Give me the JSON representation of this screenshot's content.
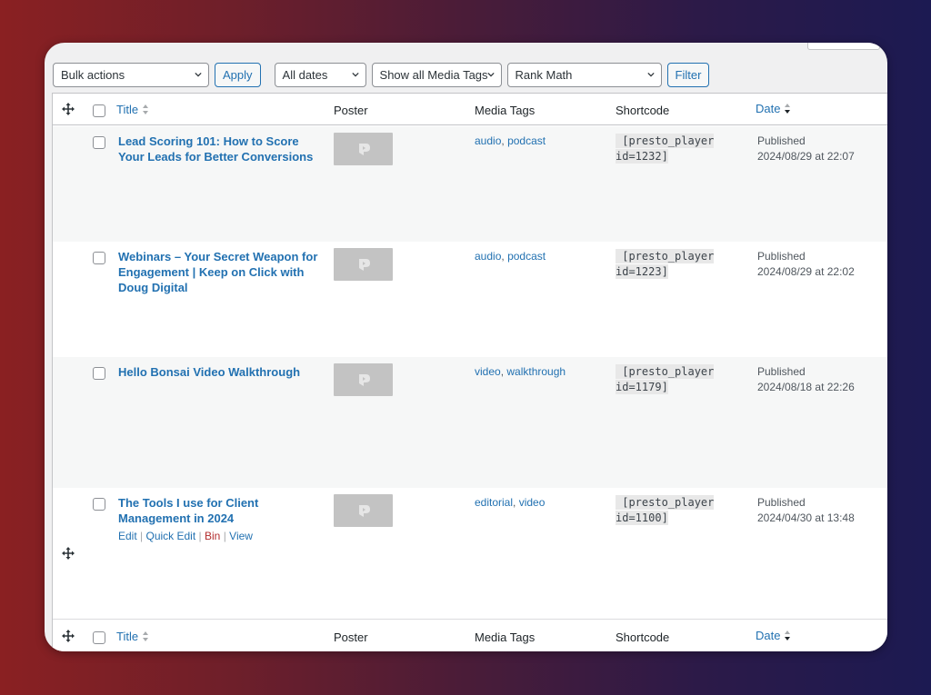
{
  "toolbar": {
    "bulk_actions": "Bulk actions",
    "apply_label": "Apply",
    "dates_filter": "All dates",
    "media_tags_filter": "Show all Media Tags",
    "seo_filter": "Rank Math",
    "filter_label": "Filter"
  },
  "columns": {
    "title": "Title",
    "poster": "Poster",
    "media_tags": "Media Tags",
    "shortcode": "Shortcode",
    "date": "Date"
  },
  "rows": [
    {
      "title": "Lead Scoring 101: How to Score Your Leads for Better Conversions",
      "tags": [
        "audio",
        "podcast"
      ],
      "shortcode_line1": " [presto_player",
      "shortcode_line2": "id=1232]",
      "status": "Published",
      "date": "2024/08/29 at 22:07"
    },
    {
      "title": "Webinars – Your Secret Weapon for Engagement | Keep on Click with Doug Digital",
      "tags": [
        "audio",
        "podcast"
      ],
      "shortcode_line1": " [presto_player",
      "shortcode_line2": "id=1223]",
      "status": "Published",
      "date": "2024/08/29 at 22:02"
    },
    {
      "title": "Hello Bonsai Video Walkthrough",
      "tags": [
        "video",
        "walkthrough"
      ],
      "shortcode_line1": " [presto_player",
      "shortcode_line2": "id=1179]",
      "status": "Published",
      "date": "2024/08/18 at 22:26"
    },
    {
      "title": "The Tools I use for Client Management in 2024",
      "tags": [
        "editorial",
        "video"
      ],
      "shortcode_line1": " [presto_player",
      "shortcode_line2": "id=1100]",
      "status": "Published",
      "date": "2024/04/30 at 13:48"
    }
  ],
  "row_actions": {
    "edit": "Edit",
    "quick_edit": "Quick Edit",
    "bin": "Bin",
    "view": "View",
    "separator": "|"
  },
  "tag_separator": ",",
  "colors": {
    "link": "#2271b1",
    "danger": "#b32d2e",
    "alt_row": "#f6f7f7"
  }
}
